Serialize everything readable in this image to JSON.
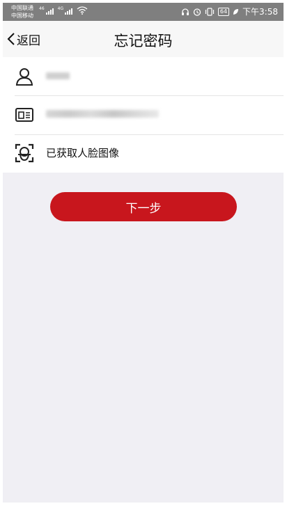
{
  "status_bar": {
    "carrier_1": "中国联通",
    "carrier_2": "中国移动",
    "battery": "64",
    "time": "下午3:58"
  },
  "nav": {
    "back_label": "返回",
    "title": "忘记密码"
  },
  "form": {
    "name_value": "",
    "id_value": "",
    "face_label": "已获取人脸图像"
  },
  "actions": {
    "next_label": "下一步"
  },
  "colors": {
    "accent": "#c8161d",
    "background": "#f0eff4"
  }
}
